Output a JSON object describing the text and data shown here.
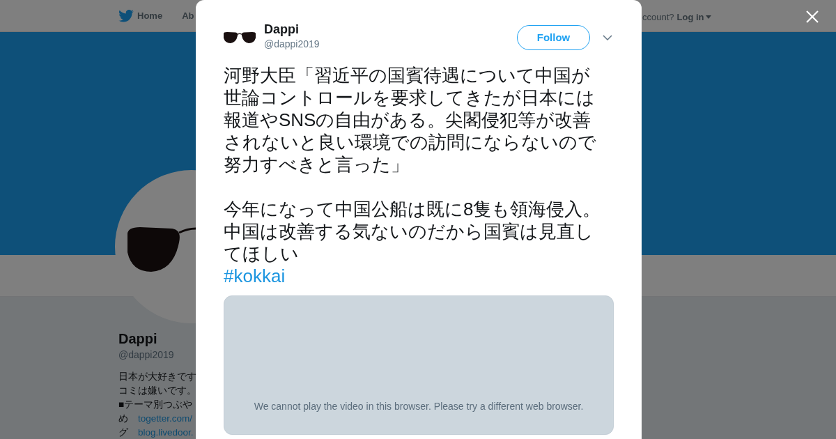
{
  "background_page": {
    "header": {
      "nav": [
        {
          "label": "Home"
        },
        {
          "label": "Ab"
        }
      ],
      "account_prompt": "ccount?",
      "login": "Log in"
    },
    "profile": {
      "name": "Dappi",
      "handle": "@dappi2019",
      "bio": [
        {
          "kind": "text",
          "text": "日本が大好きです"
        },
        {
          "kind": "text",
          "text": "コミは嫌いです。"
        },
        {
          "kind": "text",
          "text": "■テーマ別つぶや"
        },
        {
          "kind": "link",
          "prefix": "め",
          "link": "togetter.com/"
        },
        {
          "kind": "link",
          "prefix": "グ",
          "link": "blog.livedoor."
        }
      ]
    }
  },
  "tweet": {
    "author": {
      "name": "Dappi",
      "handle": "@dappi2019"
    },
    "follow_button": "Follow",
    "paragraphs": [
      "河野大臣「習近平の国賓待遇について中国が世論コントロールを要求してきたが日本には報道やSNSの自由がある。尖閣侵犯等が改善されないと良い環境での訪問にならないので努力すべきと言った」",
      "今年になって中国公船は既に8隻も領海侵入。",
      "中国は改善する気ないのだから国賓は見直してほしい"
    ],
    "hashtag": "#kokkai",
    "video": {
      "message": "We cannot play the video in this browser. Please try a different web browser."
    }
  }
}
